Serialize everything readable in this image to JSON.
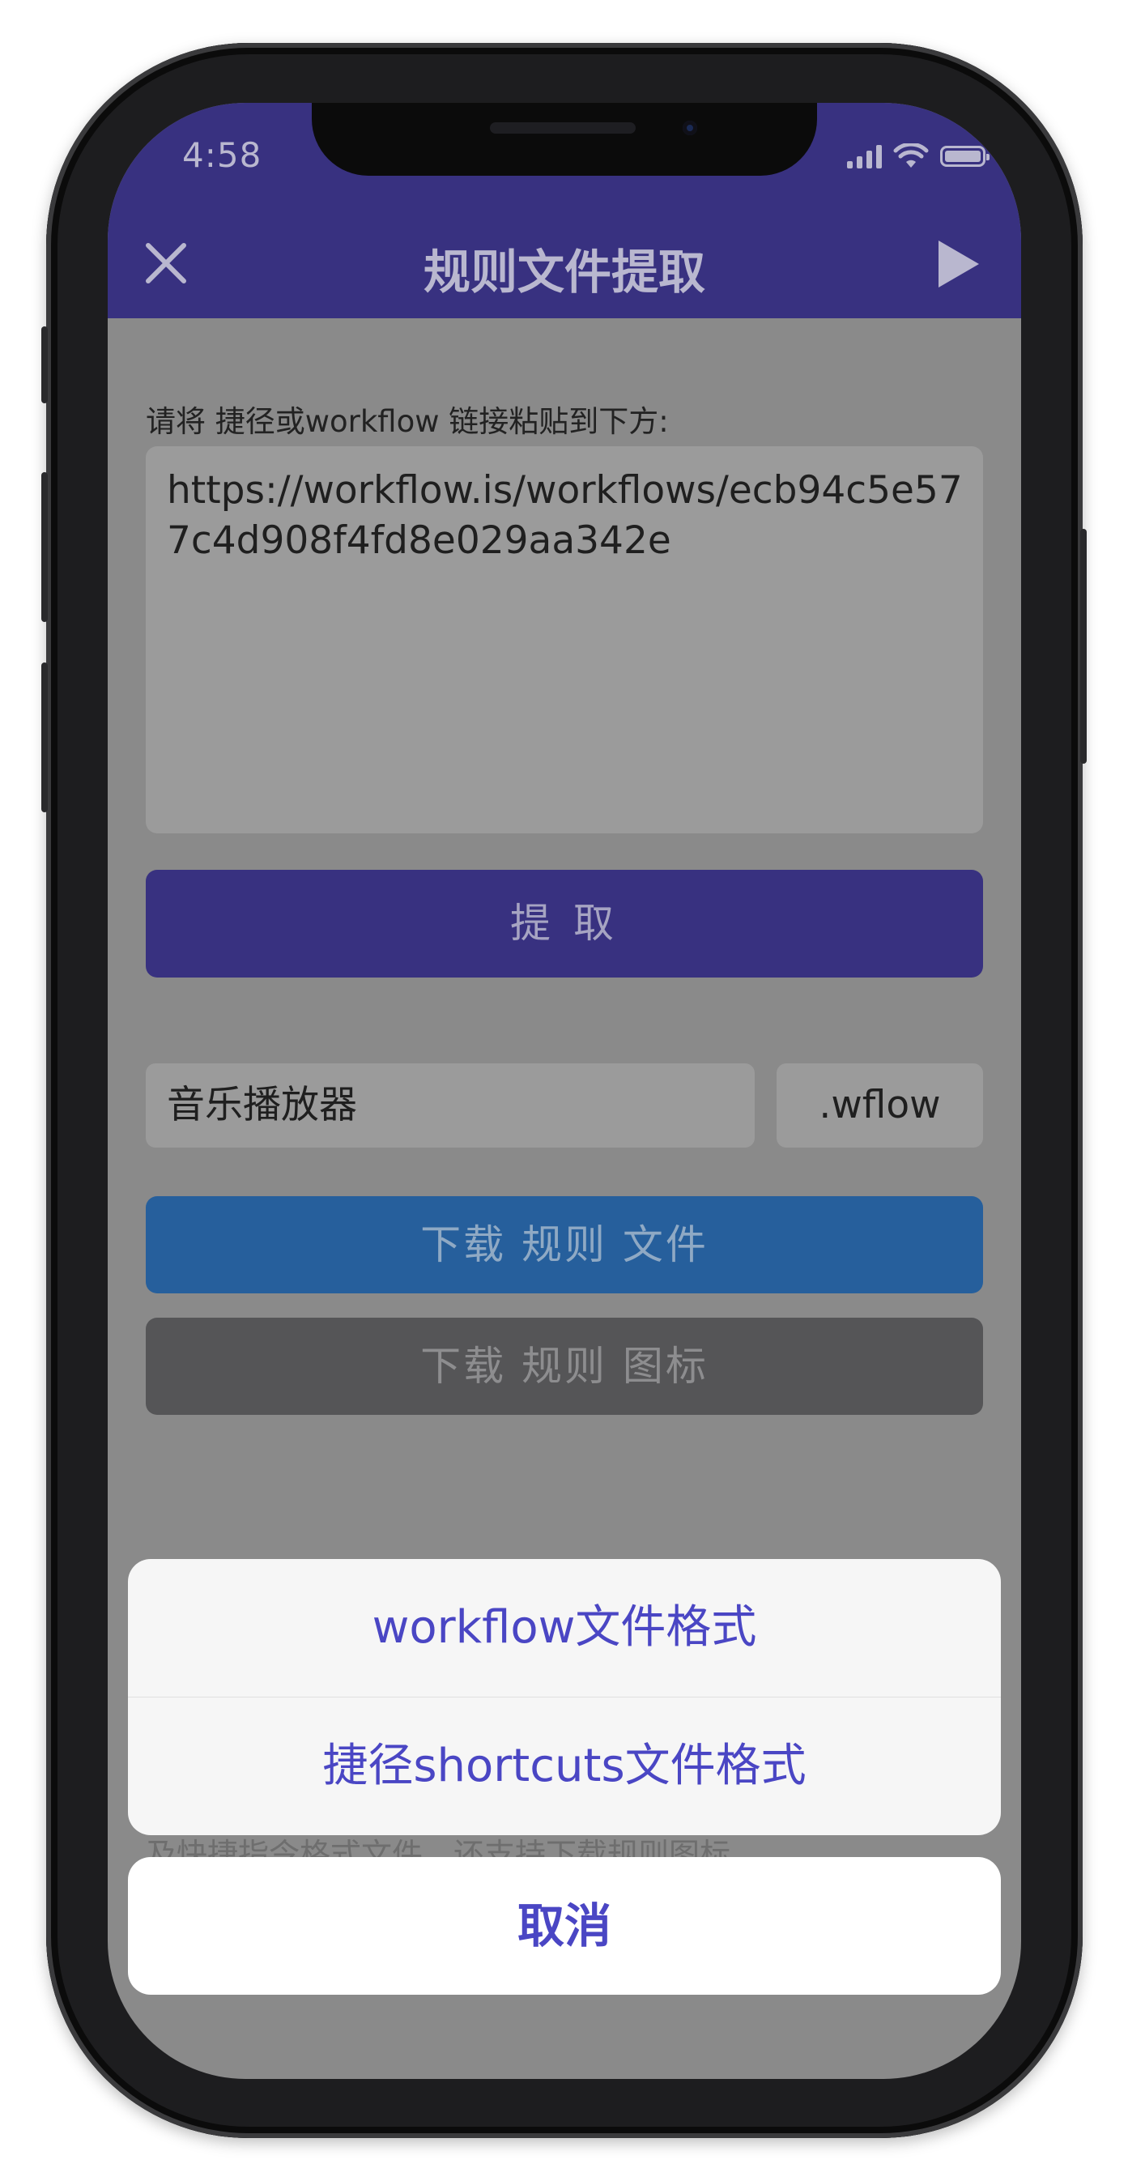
{
  "status_bar": {
    "time": "4:58"
  },
  "nav": {
    "title": "规则文件提取",
    "close_icon": "close-icon",
    "play_icon": "play-icon"
  },
  "form": {
    "prompt": "请将 捷径或workflow 链接粘贴到下方:",
    "url_value": "https://workflow.is/workflows/ecb94c5e577c4d908f4fd8e029aa342e",
    "extract_label": "提 取",
    "name_value": "音乐播放器",
    "extension_value": ".wflow",
    "download_file_label": "下载 规则 文件",
    "download_icon_label": "下载 规则 图标",
    "behind_text": "及快捷指令格式文件，还支持下载规则图标"
  },
  "action_sheet": {
    "options": [
      "workflow文件格式",
      "捷径shortcuts文件格式"
    ],
    "cancel_label": "取消"
  },
  "colors": {
    "nav_bg": "#383180",
    "extract_button": "#383180",
    "download_file_button": "#265f9c",
    "download_icon_button": "#555557",
    "sheet_text": "#4a46c4"
  }
}
